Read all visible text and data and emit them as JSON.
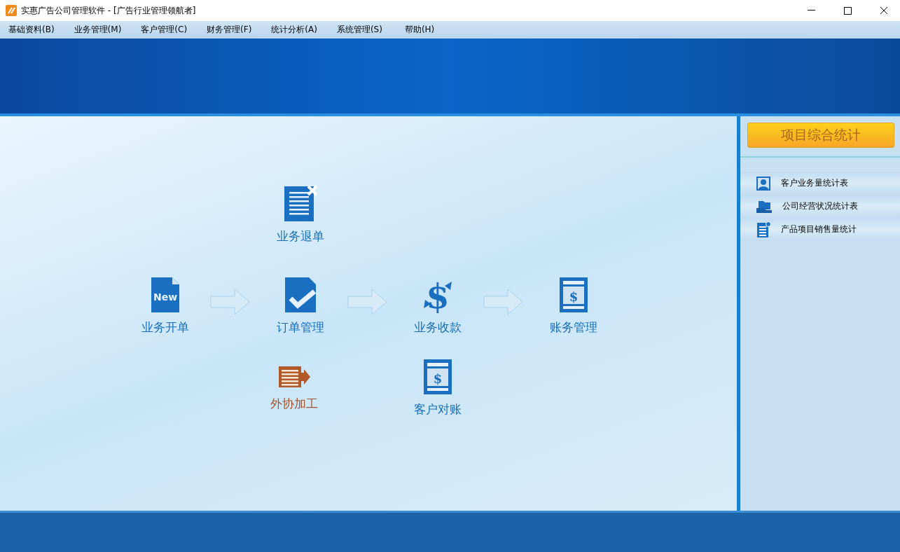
{
  "window": {
    "title": "实惠广告公司管理软件 - [广告行业管理领航者]"
  },
  "menu": [
    {
      "label": "基础资料(B)"
    },
    {
      "label": "业务管理(M)"
    },
    {
      "label": "客户管理(C)"
    },
    {
      "label": "财务管理(F)"
    },
    {
      "label": "统计分析(A)"
    },
    {
      "label": "系统管理(S)"
    },
    {
      "label": "帮助(H)"
    }
  ],
  "workflow": {
    "nodes": [
      {
        "label": "业务开单",
        "kind": "new-doc",
        "color": "#1a6fb8",
        "glyph": "New"
      },
      {
        "label": "业务退单",
        "kind": "cancel-doc",
        "color": "#1a6fb8"
      },
      {
        "label": "订单管理",
        "kind": "check-doc",
        "color": "#1a6fb8"
      },
      {
        "label": "外协加工",
        "kind": "outsource",
        "color": "#a0522d"
      },
      {
        "label": "业务收款",
        "kind": "dollar",
        "color": "#1a6fb8",
        "glyph": "$"
      },
      {
        "label": "客户对账",
        "kind": "ledger",
        "color": "#1a6fb8",
        "glyph": "$"
      },
      {
        "label": "账务管理",
        "kind": "ledger",
        "color": "#1a6fb8",
        "glyph": "$"
      }
    ]
  },
  "side_panel": {
    "title": "项目综合统计",
    "items": [
      {
        "label": "客户业务量统计表",
        "kind": "person"
      },
      {
        "label": "公司经营状况统计表",
        "kind": "folder"
      },
      {
        "label": "产品项目销售量统计",
        "kind": "report"
      }
    ]
  }
}
